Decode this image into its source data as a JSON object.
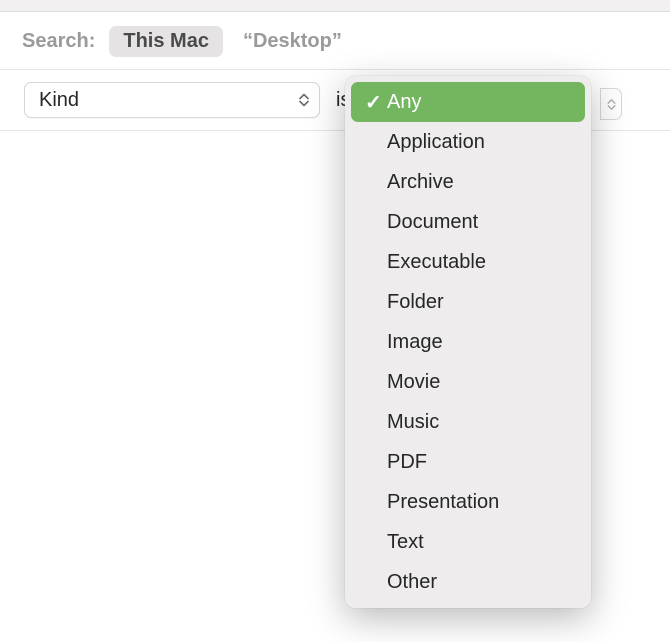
{
  "search": {
    "label": "Search:",
    "scope_active": "This Mac",
    "scope_inactive": "“Desktop”"
  },
  "criteria": {
    "attribute": "Kind",
    "operator": "is"
  },
  "dropdown": {
    "items": [
      {
        "label": "Any",
        "selected": true
      },
      {
        "label": "Application",
        "selected": false
      },
      {
        "label": "Archive",
        "selected": false
      },
      {
        "label": "Document",
        "selected": false
      },
      {
        "label": "Executable",
        "selected": false
      },
      {
        "label": "Folder",
        "selected": false
      },
      {
        "label": "Image",
        "selected": false
      },
      {
        "label": "Movie",
        "selected": false
      },
      {
        "label": "Music",
        "selected": false
      },
      {
        "label": "PDF",
        "selected": false
      },
      {
        "label": "Presentation",
        "selected": false
      },
      {
        "label": "Text",
        "selected": false
      },
      {
        "label": "Other",
        "selected": false
      }
    ]
  }
}
